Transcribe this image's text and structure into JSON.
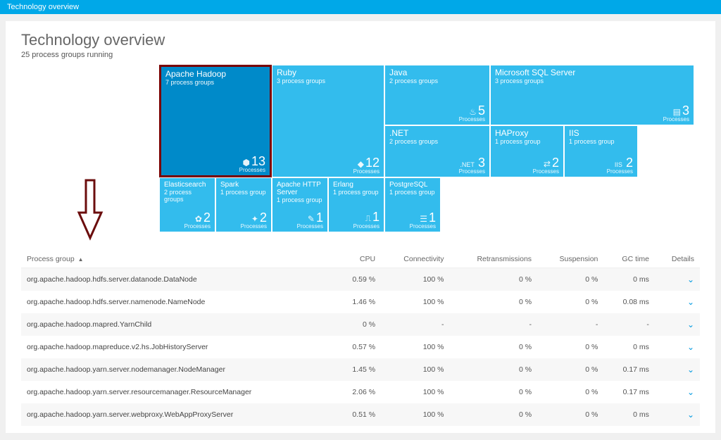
{
  "topbar": {
    "title": "Technology overview"
  },
  "header": {
    "title": "Technology overview",
    "subtitle": "25 process groups running"
  },
  "treemap": {
    "selected": "Apache Hadoop",
    "processes_label": "Processes",
    "tiles": {
      "hadoop": {
        "title": "Apache Hadoop",
        "sub": "7 process groups",
        "count": "13"
      },
      "ruby": {
        "title": "Ruby",
        "sub": "3 process groups",
        "count": "12"
      },
      "java": {
        "title": "Java",
        "sub": "2 process groups",
        "count": "5"
      },
      "mssql": {
        "title": "Microsoft SQL Server",
        "sub": "3 process groups",
        "count": "3"
      },
      "dotnet": {
        "title": ".NET",
        "sub": "2 process groups",
        "count": "3",
        "tag": ".NET"
      },
      "haproxy": {
        "title": "HAProxy",
        "sub": "1 process group",
        "count": "2"
      },
      "iis": {
        "title": "IIS",
        "sub": "1 process group",
        "count": "2",
        "tag": "IIS"
      },
      "elastic": {
        "title": "Elasticsearch",
        "sub": "2 process groups",
        "count": "2"
      },
      "spark": {
        "title": "Spark",
        "sub": "1 process group",
        "count": "2"
      },
      "httpd": {
        "title": "Apache HTTP Server",
        "sub": "1 process group",
        "count": "1"
      },
      "erlang": {
        "title": "Erlang",
        "sub": "1 process group",
        "count": "1"
      },
      "postgres": {
        "title": "PostgreSQL",
        "sub": "1 process group",
        "count": "1"
      }
    }
  },
  "table": {
    "columns": {
      "pg": "Process group",
      "cpu": "CPU",
      "conn": "Connectivity",
      "retr": "Retransmissions",
      "susp": "Suspension",
      "gc": "GC time",
      "det": "Details"
    },
    "sort_indicator": "▲",
    "rows": [
      {
        "pg": "org.apache.hadoop.hdfs.server.datanode.DataNode",
        "cpu": "0.59 %",
        "conn": "100 %",
        "retr": "0 %",
        "susp": "0 %",
        "gc": "0 ms"
      },
      {
        "pg": "org.apache.hadoop.hdfs.server.namenode.NameNode",
        "cpu": "1.46 %",
        "conn": "100 %",
        "retr": "0 %",
        "susp": "0 %",
        "gc": "0.08 ms"
      },
      {
        "pg": "org.apache.hadoop.mapred.YarnChild",
        "cpu": "0 %",
        "conn": "-",
        "retr": "-",
        "susp": "-",
        "gc": "-"
      },
      {
        "pg": "org.apache.hadoop.mapreduce.v2.hs.JobHistoryServer",
        "cpu": "0.57 %",
        "conn": "100 %",
        "retr": "0 %",
        "susp": "0 %",
        "gc": "0 ms"
      },
      {
        "pg": "org.apache.hadoop.yarn.server.nodemanager.NodeManager",
        "cpu": "1.45 %",
        "conn": "100 %",
        "retr": "0 %",
        "susp": "0 %",
        "gc": "0.17 ms"
      },
      {
        "pg": "org.apache.hadoop.yarn.server.resourcemanager.ResourceManager",
        "cpu": "2.06 %",
        "conn": "100 %",
        "retr": "0 %",
        "susp": "0 %",
        "gc": "0.17 ms"
      },
      {
        "pg": "org.apache.hadoop.yarn.server.webproxy.WebAppProxyServer",
        "cpu": "0.51 %",
        "conn": "100 %",
        "retr": "0 %",
        "susp": "0 %",
        "gc": "0 ms"
      }
    ]
  }
}
